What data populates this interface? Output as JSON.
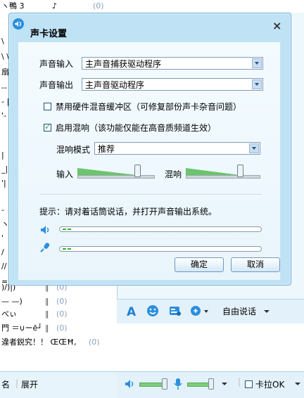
{
  "background": {
    "contacts": [
      {
        "text": "ヽ鴨 3",
        "extra": "♪",
        "count": "(0)"
      },
      {
        "text": "",
        "count": ""
      },
      {
        "text": "\\",
        "count": ""
      },
      {
        "text": "\\ \\",
        "count": ""
      },
      {
        "text": "扇",
        "count": ""
      },
      {
        "text": "--",
        "count": ""
      },
      {
        "text": "- |",
        "count": ""
      },
      {
        "text": "'-",
        "count": ""
      },
      {
        "text": "",
        "count": ""
      },
      {
        "text": "",
        "count": ""
      },
      {
        "text": "|",
        "count": ""
      },
      {
        "text": "_|",
        "count": ""
      },
      {
        "text": "'|",
        "count": ""
      },
      {
        "text": "",
        "count": ""
      },
      {
        "text": "-",
        "count": ""
      },
      {
        "text": "ヽ",
        "count": ""
      },
      {
        "text": "'",
        "count": ""
      },
      {
        "text": "/",
        "count": ""
      },
      {
        "text": "//",
        "count": ""
      },
      {
        "text": "",
        "count": ""
      },
      {
        "text": "==",
        "count": ""
      },
      {
        "text": ")/)|)",
        "bar": "‖",
        "count": "(0)"
      },
      {
        "text": "— —)",
        "bar": "‖",
        "count": "(0)"
      },
      {
        "text": "べぃ",
        "bar": "‖",
        "count": "(0)"
      },
      {
        "text": "門 ＝∪ーē┘",
        "bar": "‖",
        "count": "(0)"
      },
      {
        "text": "違者鋭究！！ ŒŒĦ, ",
        "count": "(0)"
      }
    ],
    "bottom_left": {
      "item1": "名",
      "item2": "展开"
    },
    "toolbar": {
      "say_label": "自由说话"
    },
    "bottombar": {
      "karaoke_label": "卡拉OK"
    }
  },
  "dialog": {
    "title": "声卡设置",
    "close_label": "×",
    "input_label": "声音输入",
    "input_value": "主声音捕获驱动程序",
    "output_label": "声音输出",
    "output_value": "主声音驱动程序",
    "disable_hw_label": "禁用硬件混音缓冲区（可修复部份声卡杂音问题）",
    "disable_hw_checked": false,
    "enable_reverb_label": "启用混响（该功能仅能在高音质频道生效）",
    "enable_reverb_checked": true,
    "reverb_mode_label": "混响模式",
    "reverb_mode_value": "推荐",
    "input_slider_label": "输入",
    "input_slider_level": 0.8,
    "reverb_slider_label": "混响",
    "reverb_slider_level": 0.75,
    "hint": "提示：请对着话筒说话，并打开声音输出系统。",
    "ok_label": "确定",
    "cancel_label": "取消"
  },
  "colors": {
    "accent": "#21a121",
    "frame": "#bfe2f5"
  },
  "icons": [
    "speaker-icon",
    "microphone-icon",
    "text-format-icon",
    "emoji-icon",
    "image-icon",
    "voice-chat-icon",
    "chevron-down-icon"
  ]
}
